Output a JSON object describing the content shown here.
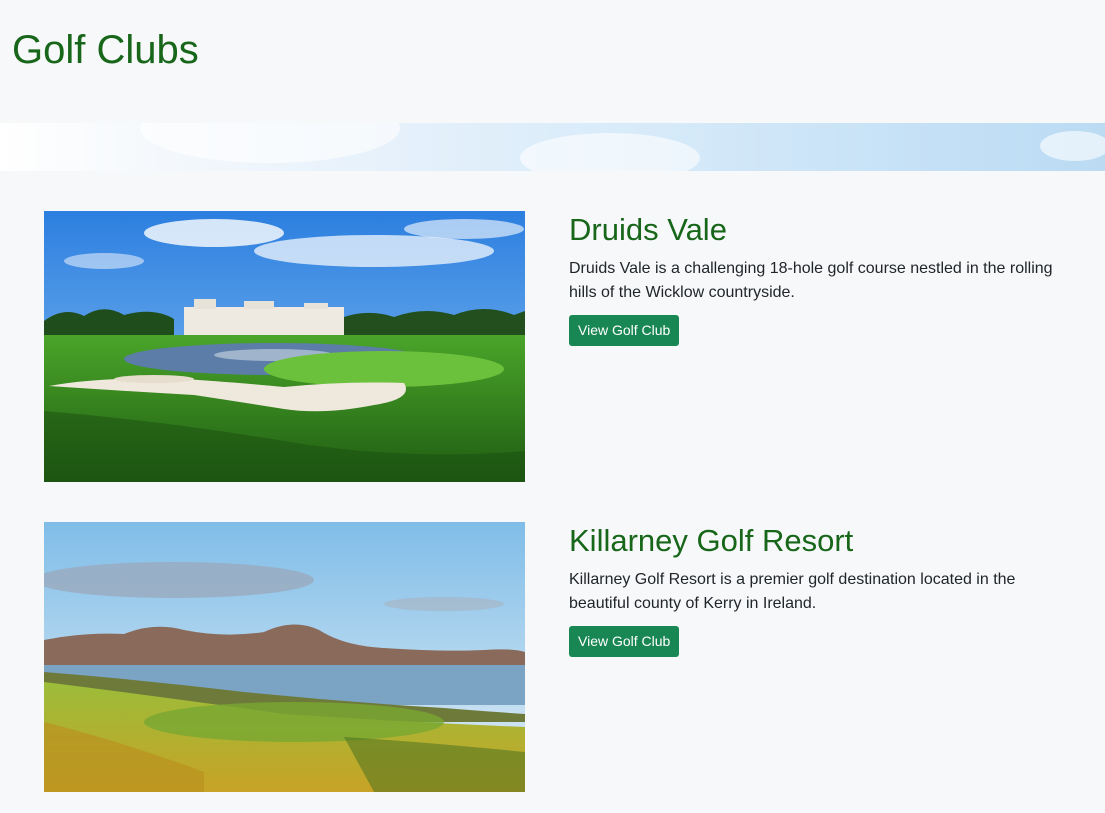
{
  "page": {
    "title": "Golf Clubs"
  },
  "clubs": [
    {
      "name": "Druids Vale",
      "description": "Druids Vale is a challenging 18-hole golf course nestled in the rolling hills of the Wicklow countryside.",
      "button_label": "View Golf Club"
    },
    {
      "name": "Killarney Golf Resort",
      "description": "Killarney Golf Resort is a premier golf destination located in the beautiful county of Kerry in Ireland.",
      "button_label": "View Golf Club"
    }
  ],
  "colors": {
    "heading": "#176619",
    "button": "#198754",
    "background": "#f7f8fa"
  }
}
